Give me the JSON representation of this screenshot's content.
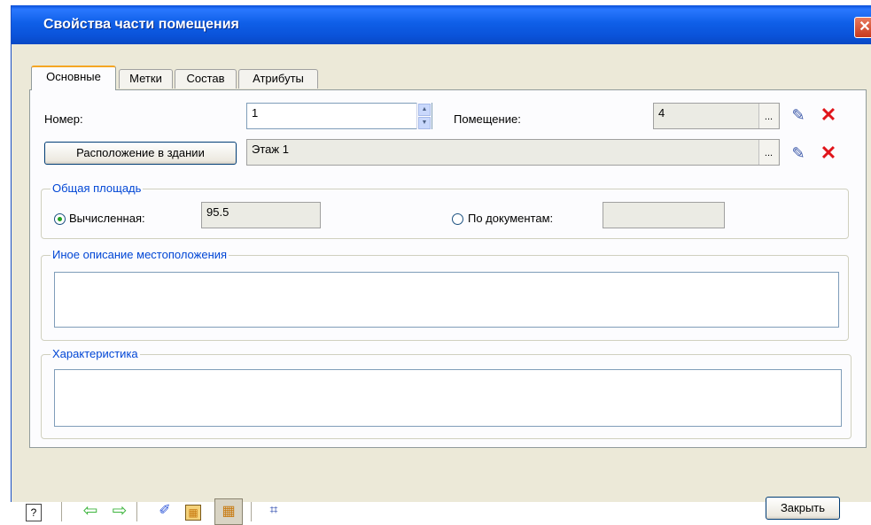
{
  "window": {
    "title": "Свойства части помещения",
    "close_glyph": "✕"
  },
  "tabs": [
    {
      "label": "Основные"
    },
    {
      "label": "Метки"
    },
    {
      "label": "Состав"
    },
    {
      "label": "Атрибуты"
    }
  ],
  "form": {
    "number_label": "Номер:",
    "number_value": "1",
    "room_label": "Помещение:",
    "room_value": "4",
    "ellipsis": "...",
    "location_button": "Расположение в здании",
    "location_value": "Этаж 1"
  },
  "area": {
    "title": "Общая площадь",
    "calculated_label": "Вычисленная:",
    "calculated_value": "95.5",
    "documents_label": "По документам:",
    "documents_value": ""
  },
  "location_desc": {
    "title": "Иное описание местоположения"
  },
  "characteristic": {
    "title": "Характеристика"
  },
  "footer": {
    "close_button": "Закрыть"
  },
  "icons": [
    "help-icon",
    "back-arrow-icon",
    "forward-arrow-icon",
    "brush-icon",
    "floorplan-icon",
    "floorplan-pressed-icon",
    "grid-icon",
    "eyedropper-icon",
    "delete-icon"
  ]
}
